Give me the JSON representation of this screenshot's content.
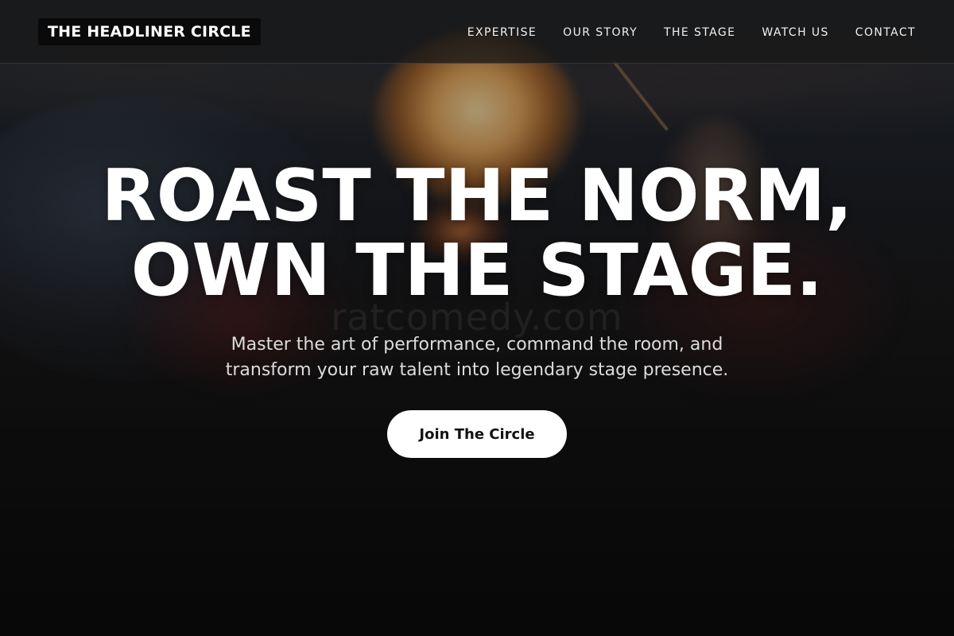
{
  "nav": {
    "brand": "THE HEADLINER CIRCLE",
    "links": [
      "EXPERTISE",
      "OUR STORY",
      "THE STAGE",
      "WATCH US",
      "CONTACT"
    ]
  },
  "hero": {
    "headline_line1": "ROAST THE NORM,",
    "headline_line2": "OWN THE STAGE.",
    "subtitle": "Master the art of performance, command the room, and transform your raw talent into legendary stage presence.",
    "cta_label": "Join The Circle",
    "watermark": "ratcomedy.com"
  },
  "colors": {
    "background": "#121212",
    "text": "#ffffff",
    "subtitle": "#dcdcdc",
    "button_bg": "#ffffff",
    "button_text": "#111111"
  }
}
